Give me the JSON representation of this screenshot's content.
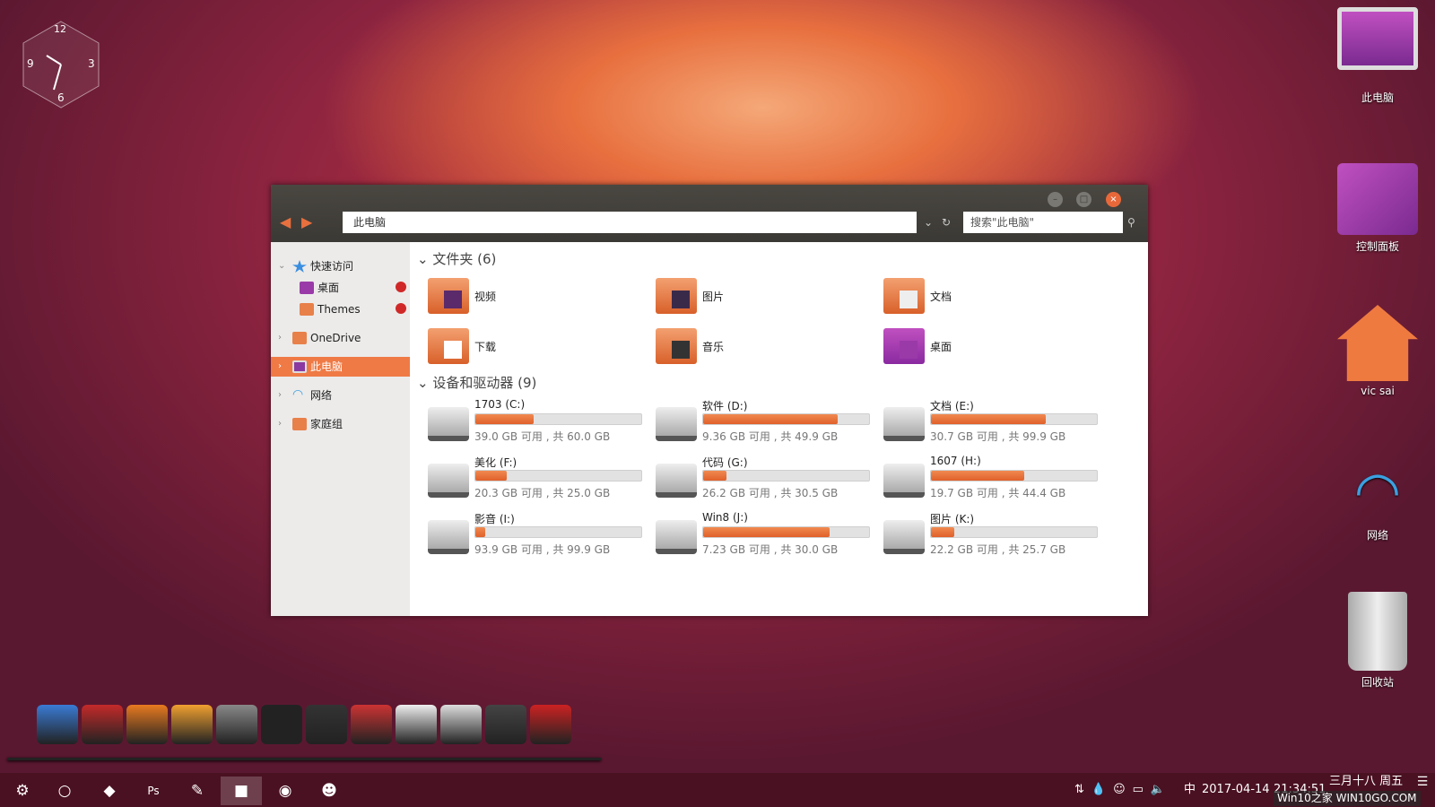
{
  "clock": {
    "n12": "12",
    "n3": "3",
    "n6": "6",
    "n9": "9"
  },
  "desktop": [
    {
      "label": "此电脑",
      "icon": "monitor-icon"
    },
    {
      "label": "控制面板",
      "icon": "control-panel-icon"
    },
    {
      "label": "vic sai",
      "icon": "home-icon"
    },
    {
      "label": "网络",
      "icon": "wifi-icon"
    },
    {
      "label": "回收站",
      "icon": "trash-icon"
    }
  ],
  "window": {
    "address": "此电脑",
    "search_placeholder": "搜索\"此电脑\"",
    "sidebar": [
      {
        "label": "快速访问",
        "icon": "star-icon",
        "expanded": true
      },
      {
        "label": "桌面",
        "icon": "desktop-folder-icon",
        "pinned": true
      },
      {
        "label": "Themes",
        "icon": "folder-icon",
        "pinned": true
      },
      {
        "label": "OneDrive",
        "icon": "folder-icon"
      },
      {
        "label": "此电脑",
        "icon": "computer-icon",
        "selected": true
      },
      {
        "label": "网络",
        "icon": "wifi-icon"
      },
      {
        "label": "家庭组",
        "icon": "homegroup-icon"
      }
    ],
    "folders_header": "文件夹 (6)",
    "folders": [
      {
        "label": "视频"
      },
      {
        "label": "图片"
      },
      {
        "label": "文档"
      },
      {
        "label": "下载"
      },
      {
        "label": "音乐"
      },
      {
        "label": "桌面"
      }
    ],
    "drives_header": "设备和驱动器 (9)",
    "drives": [
      {
        "name": "1703 (C:)",
        "status": "39.0 GB 可用 , 共 60.0 GB",
        "used_fraction": 0.35
      },
      {
        "name": "软件 (D:)",
        "status": "9.36 GB 可用 , 共 49.9 GB",
        "used_fraction": 0.81
      },
      {
        "name": "文档 (E:)",
        "status": "30.7 GB 可用 , 共 99.9 GB",
        "used_fraction": 0.69
      },
      {
        "name": "美化 (F:)",
        "status": "20.3 GB 可用 , 共 25.0 GB",
        "used_fraction": 0.19
      },
      {
        "name": "代码 (G:)",
        "status": "26.2 GB 可用 , 共 30.5 GB",
        "used_fraction": 0.14
      },
      {
        "name": "1607 (H:)",
        "status": "19.7 GB 可用 , 共 44.4 GB",
        "used_fraction": 0.56
      },
      {
        "name": "影音 (I:)",
        "status": "93.9 GB 可用 , 共 99.9 GB",
        "used_fraction": 0.06
      },
      {
        "name": "Win8 (J:)",
        "status": "7.23 GB 可用 , 共 30.0 GB",
        "used_fraction": 0.76
      },
      {
        "name": "图片 (K:)",
        "status": "22.2 GB 可用 , 共 25.7 GB",
        "used_fraction": 0.14
      }
    ]
  },
  "dock": [
    "computer",
    "settings",
    "firefox",
    "media-player",
    "fox-app",
    "play",
    "system-monitor",
    "total-commander",
    "notes",
    "calculator",
    "camera",
    "trash"
  ],
  "dock_colors": [
    "#3a7bd5",
    "#c42a2a",
    "#e87a20",
    "#f0a030",
    "#888",
    "#222",
    "#333",
    "#c33",
    "#eee",
    "#ddd",
    "#444",
    "#c22"
  ],
  "taskbar": {
    "ime": "中",
    "date": "2017-04-14",
    "time": "21:34:51",
    "lunar": "三月十八 周五",
    "watermark": "Win10之家 WIN10GO.COM"
  },
  "accent": "#ef7a45"
}
